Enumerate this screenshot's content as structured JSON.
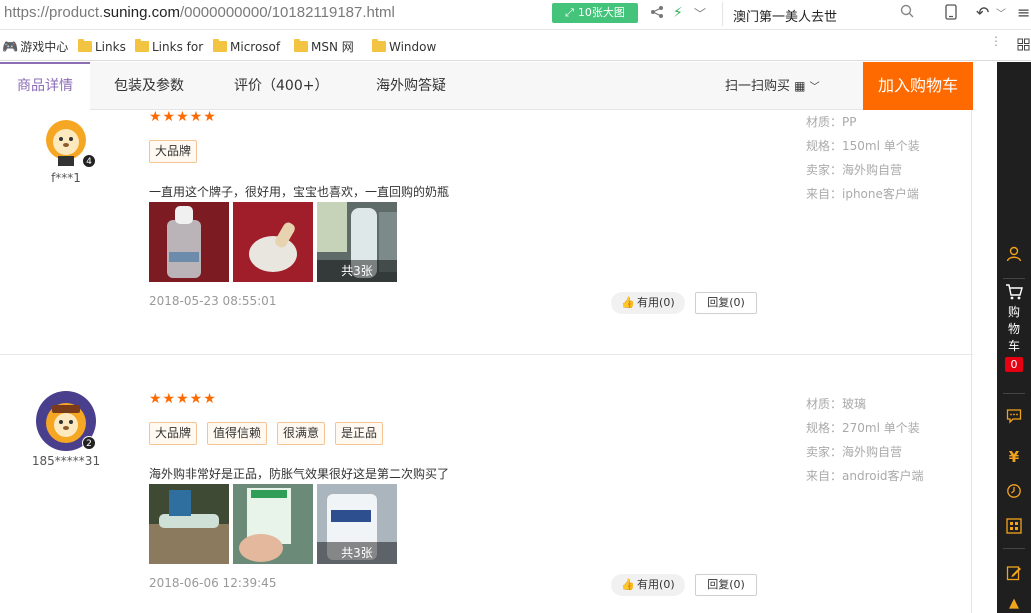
{
  "browser": {
    "url_prefix": "https://product.",
    "url_domain": "suning.com",
    "url_suffix": "/0000000000/10182119187.html",
    "big_pic_label": "10张大图",
    "search_text": "澳门第一美人去世"
  },
  "favorites": [
    {
      "label": "游戏中心",
      "icon": "gamepad-icon"
    },
    {
      "label": "Links",
      "icon": "folder-icon"
    },
    {
      "label": "Links for",
      "icon": "folder-icon"
    },
    {
      "label": "Microsof",
      "icon": "folder-icon"
    },
    {
      "label": "MSN 网",
      "icon": "folder-icon"
    },
    {
      "label": "Window",
      "icon": "folder-icon"
    }
  ],
  "tabs": {
    "detail": "商品详情",
    "package": "包装及参数",
    "reviews": "评价（400+）",
    "qa": "海外购答疑",
    "scan": "扫一扫购买",
    "add_cart": "加入购物车"
  },
  "sidebar": {
    "cart_chars": [
      "购",
      "物",
      "车"
    ],
    "cart_count": "0",
    "accent": "#f2a31d"
  },
  "reviews": [
    {
      "user": "f***1",
      "stars": "★★★★★",
      "tags": [
        "大品牌"
      ],
      "text": "一直用这个牌子，很好用，宝宝也喜欢，一直回购的奶瓶",
      "more_label": "共3张",
      "date": "2018-05-23 08:55:01",
      "useful": "有用(0)",
      "reply": "回复(0)",
      "meta": [
        "材质：PP",
        "规格：150ml 单个装",
        "卖家：海外购自营",
        "来自：iphone客户端"
      ]
    },
    {
      "user": "185*****31",
      "stars": "★★★★★",
      "tags": [
        "大品牌",
        "值得信赖",
        "很满意",
        "是正品"
      ],
      "text": "海外购非常好是正品，防胀气效果很好这是第二次购买了",
      "more_label": "共3张",
      "date": "2018-06-06 12:39:45",
      "useful": "有用(0)",
      "reply": "回复(0)",
      "meta": [
        "材质：玻璃",
        "规格：270ml 单个装",
        "卖家：海外购自营",
        "来自：android客户端"
      ]
    }
  ],
  "colors": {
    "orange": "#ff6a00",
    "purple": "#8d6db6",
    "green": "#44c37a"
  }
}
